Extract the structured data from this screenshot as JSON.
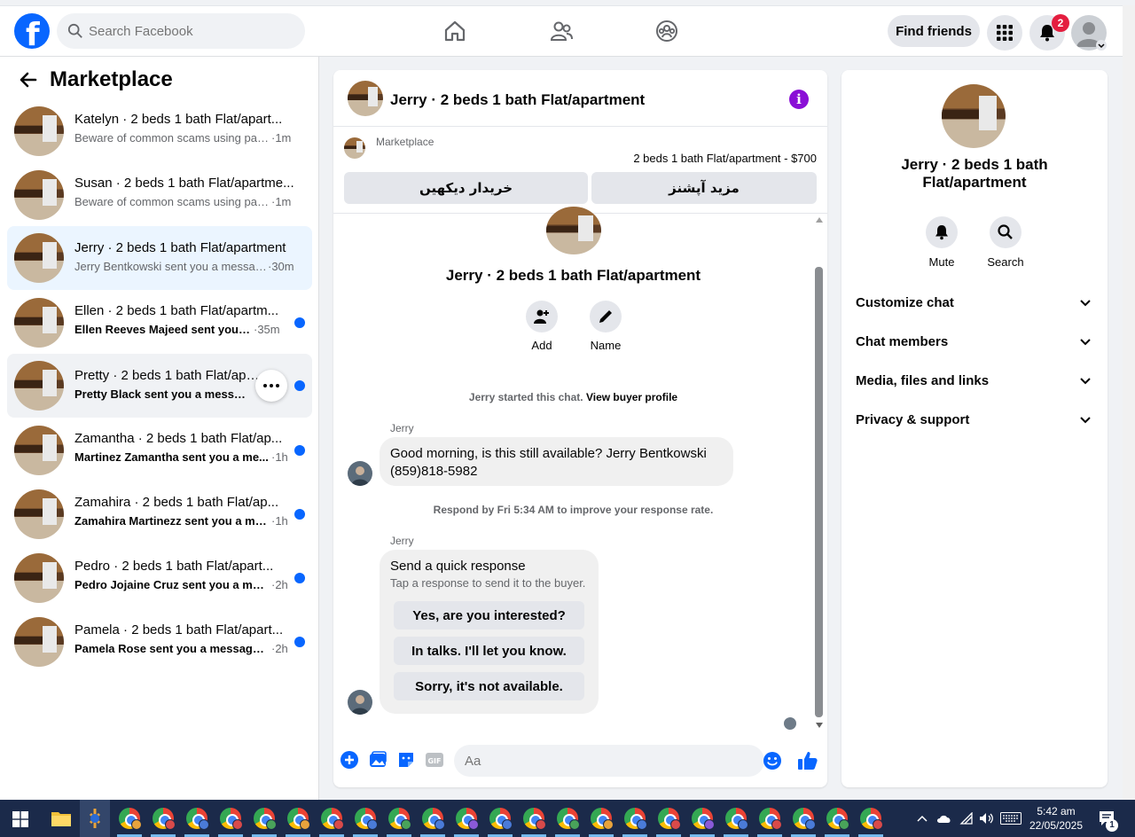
{
  "topbar": {
    "search_placeholder": "Search Facebook",
    "find_friends_label": "Find friends",
    "notification_count": "2"
  },
  "left": {
    "title": "Marketplace",
    "conversations": [
      {
        "title": "Katelyn · 2 beds 1 bath Flat/apart...",
        "preview": "Beware of common scams using pay...",
        "time": "·1m",
        "unread": false
      },
      {
        "title": "Susan · 2 beds 1 bath Flat/apartme...",
        "preview": "Beware of common scams using pay...",
        "time": "·1m",
        "unread": false
      },
      {
        "title": "Jerry · 2 beds 1 bath Flat/apartment",
        "preview": "Jerry Bentkowski sent you a messag...",
        "time": "·30m",
        "unread": false
      },
      {
        "title": "Ellen · 2 beds 1 bath Flat/apartm...",
        "preview": "Ellen Reeves Majeed sent you a ...",
        "time": "·35m",
        "unread": true
      },
      {
        "title": "Pretty · 2 beds 1 bath Flat/apart",
        "preview": "Pretty Black sent you a message ...",
        "time": "",
        "unread": true
      },
      {
        "title": "Zamantha · 2 beds 1 bath Flat/ap...",
        "preview": "Martinez Zamantha sent you a me...",
        "time": "·1h",
        "unread": true
      },
      {
        "title": "Zamahira · 2 beds 1 bath Flat/ap...",
        "preview": "Zamahira Martinezz sent you a me...",
        "time": "·1h",
        "unread": true
      },
      {
        "title": "Pedro · 2 beds 1 bath Flat/apart...",
        "preview": "Pedro Jojaine Cruz sent you a mes...",
        "time": "·2h",
        "unread": true
      },
      {
        "title": "Pamela · 2 beds 1 bath Flat/apart...",
        "preview": "Pamela Rose sent you a message a...",
        "time": "·2h",
        "unread": true
      }
    ]
  },
  "chat": {
    "title": "Jerry · 2 beds 1 bath Flat/apartment",
    "listing_source": "Marketplace",
    "listing_price": "2 beds 1 bath Flat/apartment - $700",
    "btn_view_buyer": "خریدار دیکھیں",
    "btn_more_options": "مزید آپشنز",
    "center_name": "Jerry · 2 beds 1 bath Flat/apartment",
    "action_add": "Add",
    "action_name": "Name",
    "started_text": "Jerry started this chat.",
    "view_buyer_profile": "View buyer profile",
    "sender_1": "Jerry",
    "message_1": "Good morning, is this still available? Jerry Bentkowski (859)818-5982",
    "respond_text": "Respond by Fri 5:34 AM to improve your response rate.",
    "sender_2": "Jerry",
    "quick_title": "Send a quick response",
    "quick_sub": "Tap a response to send it to the buyer.",
    "quick_replies": [
      "Yes, are you interested?",
      "In talks. I'll let you know.",
      "Sorry, it's not available."
    ],
    "composer_placeholder": "Aa"
  },
  "right": {
    "title": "Jerry · 2 beds 1 bath Flat/apartment",
    "mute_label": "Mute",
    "search_label": "Search",
    "rows": [
      "Customize chat",
      "Chat members",
      "Media, files and links",
      "Privacy & support"
    ]
  },
  "taskbar": {
    "time": "5:42 am",
    "date": "22/05/2025",
    "notification_count": "1"
  },
  "colors": {
    "accent": "#0866ff",
    "unread_dot": "#0866ff",
    "info_icon": "#8a0fd6",
    "badge": "#e41e3f"
  }
}
